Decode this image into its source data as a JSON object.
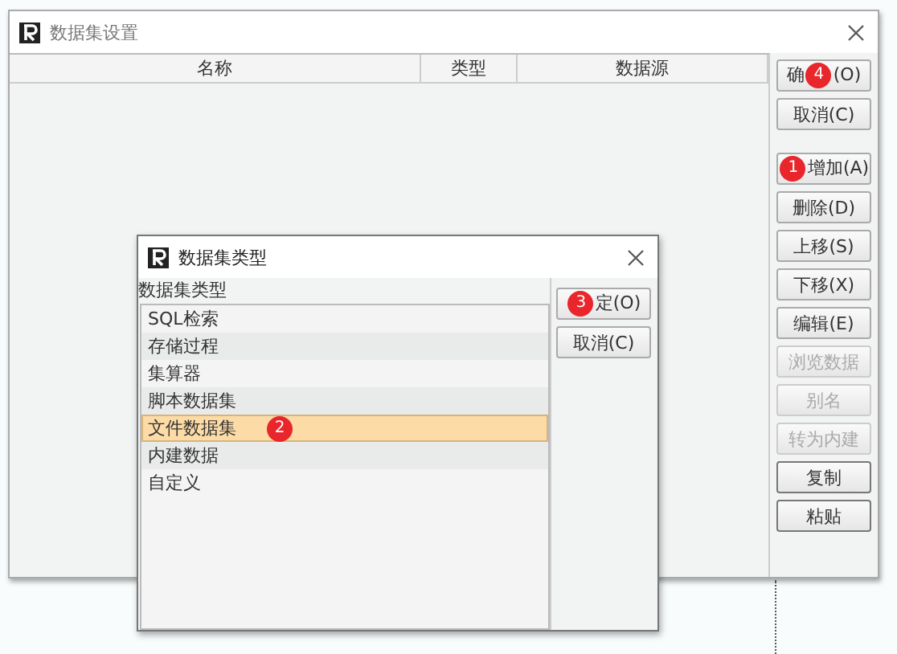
{
  "window": {
    "title": "数据集设置"
  },
  "table": {
    "columns": [
      "名称",
      "类型",
      "数据源"
    ]
  },
  "buttons": [
    {
      "label": "确",
      "disabled": false,
      "badge": "4",
      "label_after": "(O)"
    },
    {
      "label": "取消(C)",
      "disabled": false
    },
    {
      "label": "增加(A)",
      "disabled": false,
      "badge": "1",
      "gap": true
    },
    {
      "label": "删除(D)",
      "disabled": false
    },
    {
      "label": "上移(S)",
      "disabled": false
    },
    {
      "label": "下移(X)",
      "disabled": false
    },
    {
      "label": "编辑(E)",
      "disabled": false
    },
    {
      "label": "浏览数据",
      "disabled": true
    },
    {
      "label": "别名",
      "disabled": true
    },
    {
      "label": "转为内建",
      "disabled": true
    },
    {
      "label": "复制",
      "disabled": false
    },
    {
      "label": "粘贴",
      "disabled": false
    }
  ],
  "dialog": {
    "title": "数据集类型",
    "list_label": "数据集类型",
    "items": [
      {
        "label": "SQL检索",
        "selected": false
      },
      {
        "label": "存储过程",
        "selected": false
      },
      {
        "label": "集算器",
        "selected": false
      },
      {
        "label": "脚本数据集",
        "selected": false
      },
      {
        "label": "文件数据集",
        "selected": true,
        "badge": "2"
      },
      {
        "label": "内建数据",
        "selected": false
      },
      {
        "label": "自定义",
        "selected": false
      }
    ],
    "buttons": [
      {
        "label": "定(O)",
        "badge": "3"
      },
      {
        "label": "取消(C)"
      }
    ]
  }
}
